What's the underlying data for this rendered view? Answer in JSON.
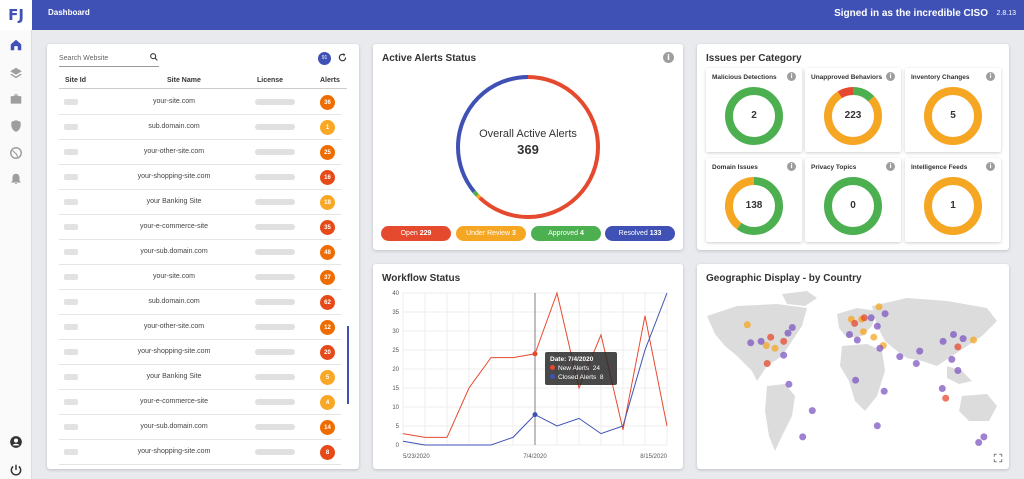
{
  "app": {
    "logo": "FJ",
    "title": "Dashboard",
    "user": "Signed in as the incredible CISO",
    "version": "2.8.13"
  },
  "nav": [
    "home-icon",
    "layers-icon",
    "briefcase-icon",
    "shield-icon",
    "globe-icon",
    "bell-icon",
    "account-icon",
    "power-icon"
  ],
  "sites": {
    "search_placeholder": "Search Website",
    "count": "91",
    "columns": [
      "Site Id",
      "Site Name",
      "License",
      "Alerts"
    ],
    "rows": [
      {
        "name": "your-site.com",
        "alerts": "36",
        "color": "#ef6c00"
      },
      {
        "name": "sub.domain.com",
        "alerts": "1",
        "color": "#f9a825"
      },
      {
        "name": "your-other-site.com",
        "alerts": "25",
        "color": "#ef6c00"
      },
      {
        "name": "your-shopping-site.com",
        "alerts": "16",
        "color": "#e64a19"
      },
      {
        "name": "your Banking Site",
        "alerts": "18",
        "color": "#f9a825"
      },
      {
        "name": "your-e-commerce-site",
        "alerts": "35",
        "color": "#e64a19"
      },
      {
        "name": "your-sub.domain.com",
        "alerts": "48",
        "color": "#ef6c00"
      },
      {
        "name": "your-site.com",
        "alerts": "37",
        "color": "#ef6c00"
      },
      {
        "name": "sub.domain.com",
        "alerts": "62",
        "color": "#e64a19"
      },
      {
        "name": "your-other-site.com",
        "alerts": "12",
        "color": "#ef6c00"
      },
      {
        "name": "your-shopping-site.com",
        "alerts": "20",
        "color": "#e64a19"
      },
      {
        "name": "your Banking Site",
        "alerts": "5",
        "color": "#f9a825"
      },
      {
        "name": "your-e-commerce-site",
        "alerts": "4",
        "color": "#f9a825"
      },
      {
        "name": "your-sub.domain.com",
        "alerts": "14",
        "color": "#ef6c00"
      },
      {
        "name": "your-shopping-site.com",
        "alerts": "8",
        "color": "#e64a19"
      }
    ]
  },
  "active_alerts": {
    "title": "Active Alerts Status",
    "center_label": "Overall Active Alerts",
    "total": "369",
    "statuses": [
      {
        "label": "Open",
        "value": 229,
        "color": "#e64a2e"
      },
      {
        "label": "Under Review",
        "value": 3,
        "color": "#f5a623"
      },
      {
        "label": "Approved",
        "value": 4,
        "color": "#4caf50"
      },
      {
        "label": "Resolved",
        "value": 133,
        "color": "#3f51b5"
      }
    ]
  },
  "categories": {
    "title": "Issues per Category",
    "items": [
      {
        "label": "Malicious Detections",
        "value": "2",
        "segments": [
          {
            "frac": 1.0,
            "color": "#4caf50"
          }
        ]
      },
      {
        "label": "Unapproved Behaviors",
        "value": "223",
        "segments": [
          {
            "frac": 0.13,
            "color": "#4caf50"
          },
          {
            "frac": 0.78,
            "color": "#f5a623"
          },
          {
            "frac": 0.09,
            "color": "#e64a2e"
          }
        ]
      },
      {
        "label": "Inventory Changes",
        "value": "5",
        "segments": [
          {
            "frac": 1.0,
            "color": "#f5a623"
          }
        ]
      },
      {
        "label": "Domain Issues",
        "value": "138",
        "segments": [
          {
            "frac": 0.6,
            "color": "#4caf50"
          },
          {
            "frac": 0.4,
            "color": "#f5a623"
          }
        ]
      },
      {
        "label": "Privacy Topics",
        "value": "0",
        "segments": [
          {
            "frac": 1.0,
            "color": "#4caf50"
          }
        ]
      },
      {
        "label": "Intelligence Feeds",
        "value": "1",
        "segments": [
          {
            "frac": 1.0,
            "color": "#f5a623"
          }
        ]
      }
    ]
  },
  "workflow": {
    "title": "Workflow Status",
    "tooltip": {
      "date": "Date: 7/4/2020",
      "new_label": "New Alerts",
      "new_value": "24",
      "closed_label": "Closed Alerts",
      "closed_value": "8"
    }
  },
  "chart_data": {
    "type": "line",
    "x": [
      "5/23/2020",
      "5/30/2020",
      "6/6/2020",
      "6/13/2020",
      "6/20/2020",
      "6/27/2020",
      "7/4/2020",
      "7/11/2020",
      "7/18/2020",
      "7/25/2020",
      "8/1/2020",
      "8/8/2020",
      "8/15/2020"
    ],
    "x_tick_labels": [
      "5/23/2020",
      "7/4/2020",
      "8/15/2020"
    ],
    "ylim": [
      0,
      40
    ],
    "yticks": [
      0,
      5,
      10,
      15,
      20,
      25,
      30,
      35,
      40
    ],
    "series": [
      {
        "name": "New Alerts",
        "color": "#e64a2e",
        "values": [
          3,
          2,
          2,
          15,
          23,
          23,
          24,
          40,
          15,
          29,
          4,
          34,
          5
        ]
      },
      {
        "name": "Closed Alerts",
        "color": "#3f51b5",
        "values": [
          1,
          0,
          0,
          0,
          0,
          2,
          8,
          5,
          7,
          3,
          5,
          25,
          40
        ]
      }
    ],
    "grid": true
  },
  "map": {
    "title": "Geographic Display - by Country",
    "markers": [
      {
        "lng": -95,
        "lat": 38,
        "color": "#e64a2e"
      },
      {
        "lng": -100,
        "lat": 32,
        "color": "#f5a623"
      },
      {
        "lng": -80,
        "lat": 35,
        "color": "#e64a2e"
      },
      {
        "lng": -75,
        "lat": 41,
        "color": "#7e57c2"
      },
      {
        "lng": -118,
        "lat": 34,
        "color": "#7e57c2"
      },
      {
        "lng": -122,
        "lat": 47,
        "color": "#f5a623"
      },
      {
        "lng": -90,
        "lat": 30,
        "color": "#f5a623"
      },
      {
        "lng": -99,
        "lat": 19,
        "color": "#e64a2e"
      },
      {
        "lng": -70,
        "lat": 45,
        "color": "#7e57c2"
      },
      {
        "lng": -106,
        "lat": 35,
        "color": "#7e57c2"
      },
      {
        "lng": -80,
        "lat": 25,
        "color": "#7e57c2"
      },
      {
        "lng": -74,
        "lat": 4,
        "color": "#7e57c2"
      },
      {
        "lng": -47,
        "lat": -15,
        "color": "#7e57c2"
      },
      {
        "lng": -58,
        "lat": -34,
        "color": "#7e57c2"
      },
      {
        "lng": -2,
        "lat": 51,
        "color": "#f5a623"
      },
      {
        "lng": 2,
        "lat": 48,
        "color": "#e64a2e"
      },
      {
        "lng": 10,
        "lat": 51,
        "color": "#f5a623"
      },
      {
        "lng": 13,
        "lat": 52,
        "color": "#e64a2e"
      },
      {
        "lng": 21,
        "lat": 52,
        "color": "#7e57c2"
      },
      {
        "lng": 12,
        "lat": 42,
        "color": "#f5a623"
      },
      {
        "lng": -4,
        "lat": 40,
        "color": "#7e57c2"
      },
      {
        "lng": 28,
        "lat": 46,
        "color": "#7e57c2"
      },
      {
        "lng": 37,
        "lat": 55,
        "color": "#7e57c2"
      },
      {
        "lng": 30,
        "lat": 60,
        "color": "#f5a623"
      },
      {
        "lng": 24,
        "lat": 38,
        "color": "#f5a623"
      },
      {
        "lng": 35,
        "lat": 32,
        "color": "#f5a623"
      },
      {
        "lng": 31,
        "lat": 30,
        "color": "#7e57c2"
      },
      {
        "lng": 5,
        "lat": 36,
        "color": "#7e57c2"
      },
      {
        "lng": 3,
        "lat": 7,
        "color": "#7e57c2"
      },
      {
        "lng": 28,
        "lat": -26,
        "color": "#7e57c2"
      },
      {
        "lng": 36,
        "lat": -1,
        "color": "#7e57c2"
      },
      {
        "lng": 54,
        "lat": 24,
        "color": "#7e57c2"
      },
      {
        "lng": 77,
        "lat": 28,
        "color": "#7e57c2"
      },
      {
        "lng": 73,
        "lat": 19,
        "color": "#7e57c2"
      },
      {
        "lng": 104,
        "lat": 35,
        "color": "#7e57c2"
      },
      {
        "lng": 116,
        "lat": 40,
        "color": "#7e57c2"
      },
      {
        "lng": 121,
        "lat": 31,
        "color": "#e64a2e"
      },
      {
        "lng": 127,
        "lat": 37,
        "color": "#7e57c2"
      },
      {
        "lng": 139,
        "lat": 36,
        "color": "#f5a623"
      },
      {
        "lng": 114,
        "lat": 22,
        "color": "#7e57c2"
      },
      {
        "lng": 103,
        "lat": 1,
        "color": "#7e57c2"
      },
      {
        "lng": 107,
        "lat": -6,
        "color": "#e64a2e"
      },
      {
        "lng": 121,
        "lat": 14,
        "color": "#7e57c2"
      },
      {
        "lng": 151,
        "lat": -34,
        "color": "#7e57c2"
      },
      {
        "lng": 145,
        "lat": -38,
        "color": "#7e57c2"
      }
    ]
  }
}
